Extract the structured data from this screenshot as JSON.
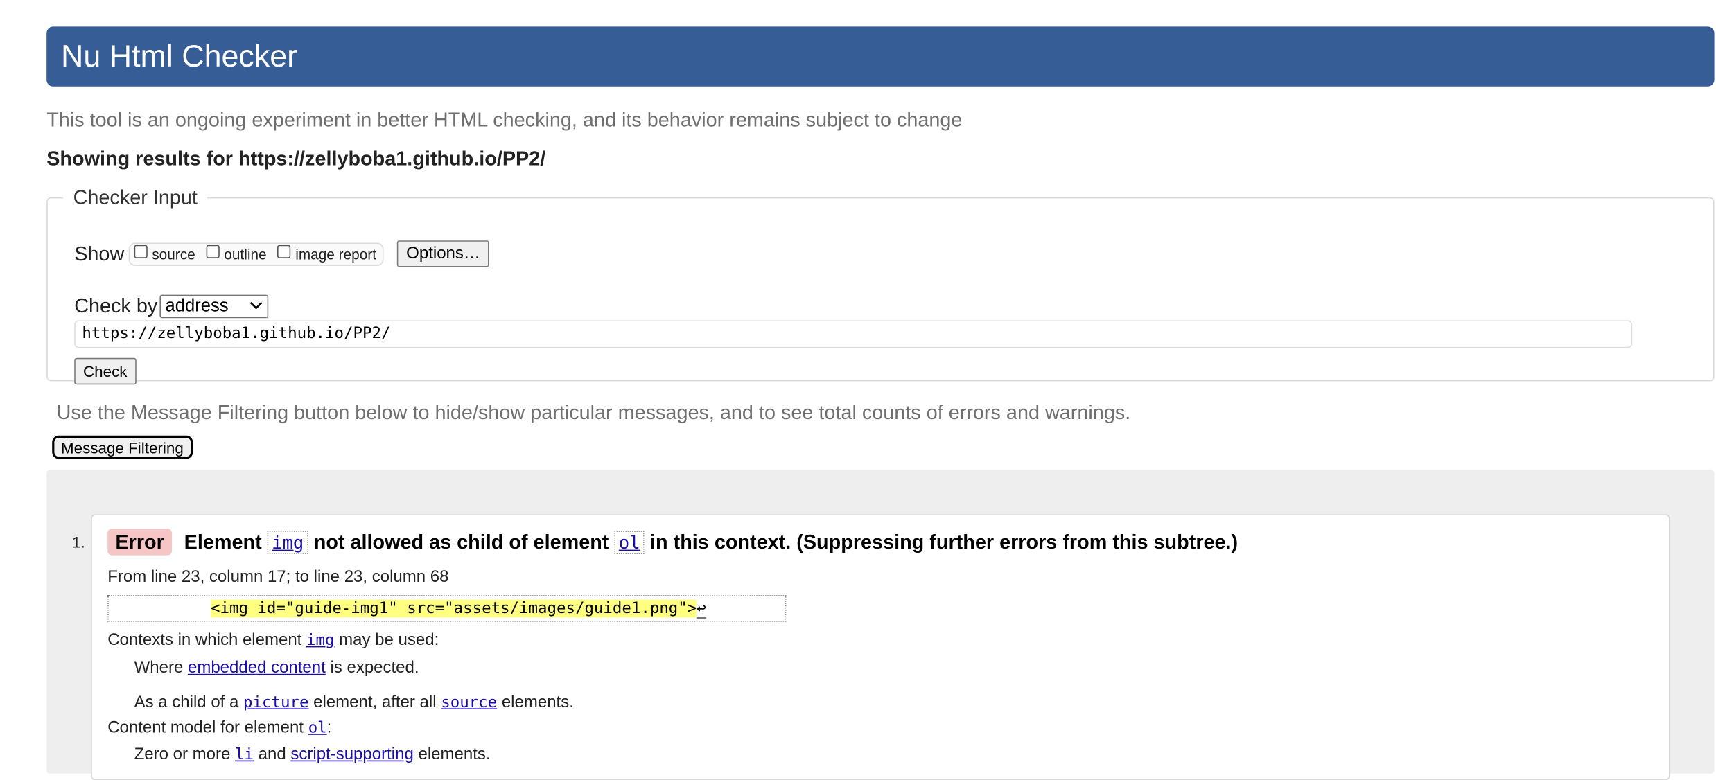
{
  "header": {
    "title": "Nu Html Checker",
    "subtitle": "This tool is an ongoing experiment in better HTML checking, and its behavior remains subject to change",
    "showing_prefix": "Showing results for",
    "showing_url": "https://zellyboba1.github.io/PP2/"
  },
  "checker_input": {
    "legend": "Checker Input",
    "show_label": "Show",
    "show_options": [
      {
        "label": "source",
        "checked": false
      },
      {
        "label": "outline",
        "checked": false
      },
      {
        "label": "image report",
        "checked": false
      }
    ],
    "options_button": "Options…",
    "check_by_label": "Check by",
    "check_by_value": "address",
    "url_value": "https://zellyboba1.github.io/PP2/",
    "check_button": "Check"
  },
  "filtering": {
    "note": "Use the Message Filtering button below to hide/show particular messages, and to see total counts of errors and warnings.",
    "button": "Message Filtering"
  },
  "messages": [
    {
      "number": "1.",
      "type": "Error",
      "text_1": "Element",
      "element_1": "img",
      "text_2": "not allowed as child of element",
      "element_2": "ol",
      "text_3": "in this context. (Suppressing further errors from this subtree.)",
      "location": "From line 23, column 17; to line 23, column 68",
      "extract": "<img id=\"guide-img1\" src=\"assets/images/guide1.png\">",
      "extract_lf": "↩",
      "contexts_prefix": "Contexts in which element",
      "contexts_element": "img",
      "contexts_suffix": "may be used:",
      "context_1_prefix": "Where",
      "context_1_link": "embedded content",
      "context_1_suffix": "is expected.",
      "context_2_prefix": "As a child of a",
      "context_2_link1": "picture",
      "context_2_mid": "element, after all",
      "context_2_link2": "source",
      "context_2_suffix": "elements.",
      "model_prefix": "Content model for element",
      "model_element": "ol",
      "model_colon": ":",
      "model_1_prefix": "Zero or more",
      "model_1_link1": "li",
      "model_1_mid": "and",
      "model_1_link2": "script-supporting",
      "model_1_suffix": "elements."
    }
  ],
  "colors": {
    "title_bar": "#365d95",
    "error_badge": "#f6c6c6",
    "highlight": "#ffff80",
    "link": "#1a0dab"
  }
}
